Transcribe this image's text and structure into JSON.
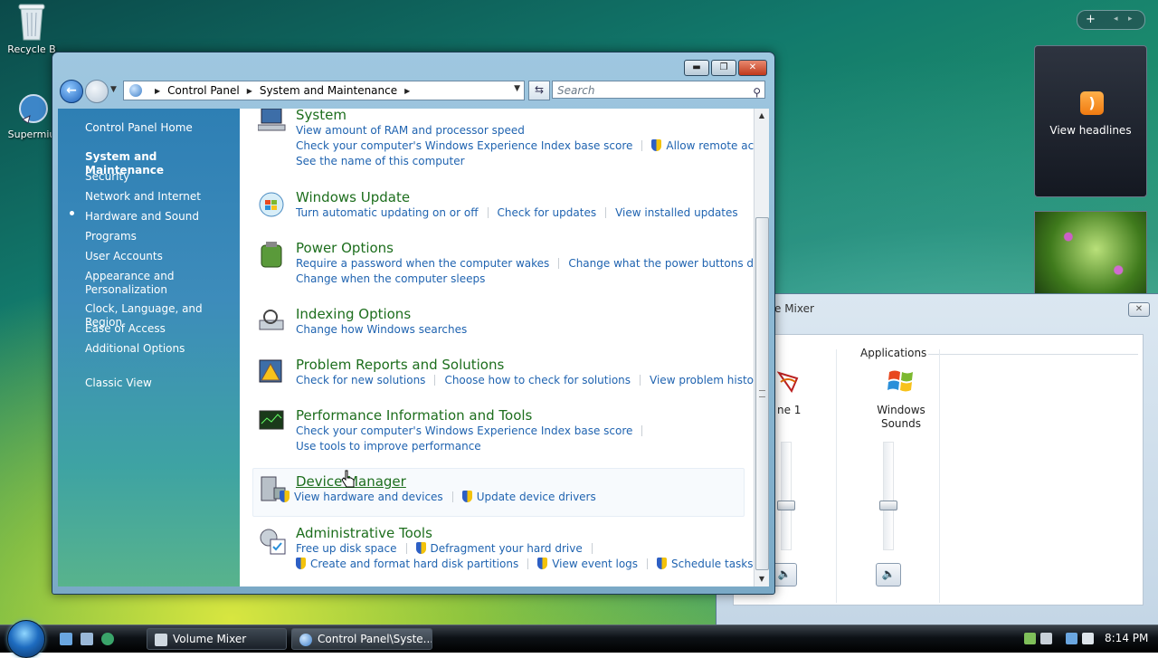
{
  "desktop": {
    "icons": [
      {
        "label": "Recycle B"
      },
      {
        "label": "Supermiu"
      }
    ]
  },
  "window": {
    "breadcrumb": [
      "Control Panel",
      "System and Maintenance"
    ],
    "search_placeholder": "Search"
  },
  "left_nav": {
    "items": [
      "Control Panel Home",
      "System and Maintenance",
      "Security",
      "Network and Internet",
      "Hardware and Sound",
      "Programs",
      "User Accounts",
      "Appearance and Personalization",
      "Clock, Language, and Region",
      "Ease of Access",
      "Additional Options",
      "Classic View"
    ]
  },
  "categories": [
    {
      "title": "System",
      "lines": [
        [
          "View amount of RAM and processor speed"
        ],
        [
          "Check your computer's Windows Experience Index base score",
          "Allow remote access"
        ],
        [
          "See the name of this computer"
        ]
      ]
    },
    {
      "title": "Windows Update",
      "lines": [
        [
          "Turn automatic updating on or off",
          "Check for updates",
          "View installed updates"
        ]
      ]
    },
    {
      "title": "Power Options",
      "lines": [
        [
          "Require a password when the computer wakes",
          "Change what the power buttons do"
        ],
        [
          "Change when the computer sleeps"
        ]
      ]
    },
    {
      "title": "Indexing Options",
      "lines": [
        [
          "Change how Windows searches"
        ]
      ]
    },
    {
      "title": "Problem Reports and Solutions",
      "lines": [
        [
          "Check for new solutions",
          "Choose how to check for solutions",
          "View problem history"
        ]
      ]
    },
    {
      "title": "Performance Information and Tools",
      "lines": [
        [
          "Check your computer's Windows Experience Index base score"
        ],
        [
          "Use tools to improve performance"
        ]
      ]
    },
    {
      "title": "Device Manager",
      "lines": [
        [
          "View hardware and devices",
          "Update device drivers"
        ]
      ]
    },
    {
      "title": "Administrative Tools",
      "lines": [
        [
          "Free up disk space",
          "Defragment your hard drive"
        ],
        [
          "Create and format hard disk partitions",
          "View event logs",
          "Schedule tasks"
        ]
      ]
    }
  ],
  "mixer": {
    "title": "e Mixer",
    "section_label": "Applications",
    "device_partial": "ne 1",
    "app_name": "Windows Sounds"
  },
  "gadgets": {
    "rss_label": "View headlines"
  },
  "taskbar": {
    "tasks": [
      "Volume Mixer",
      "Control Panel\\Syste..."
    ],
    "clock": "8:14 PM"
  },
  "colors": {
    "link": "#1f63b0",
    "category_title": "#1d6e1d",
    "left_pane": "#2e7fb4"
  }
}
